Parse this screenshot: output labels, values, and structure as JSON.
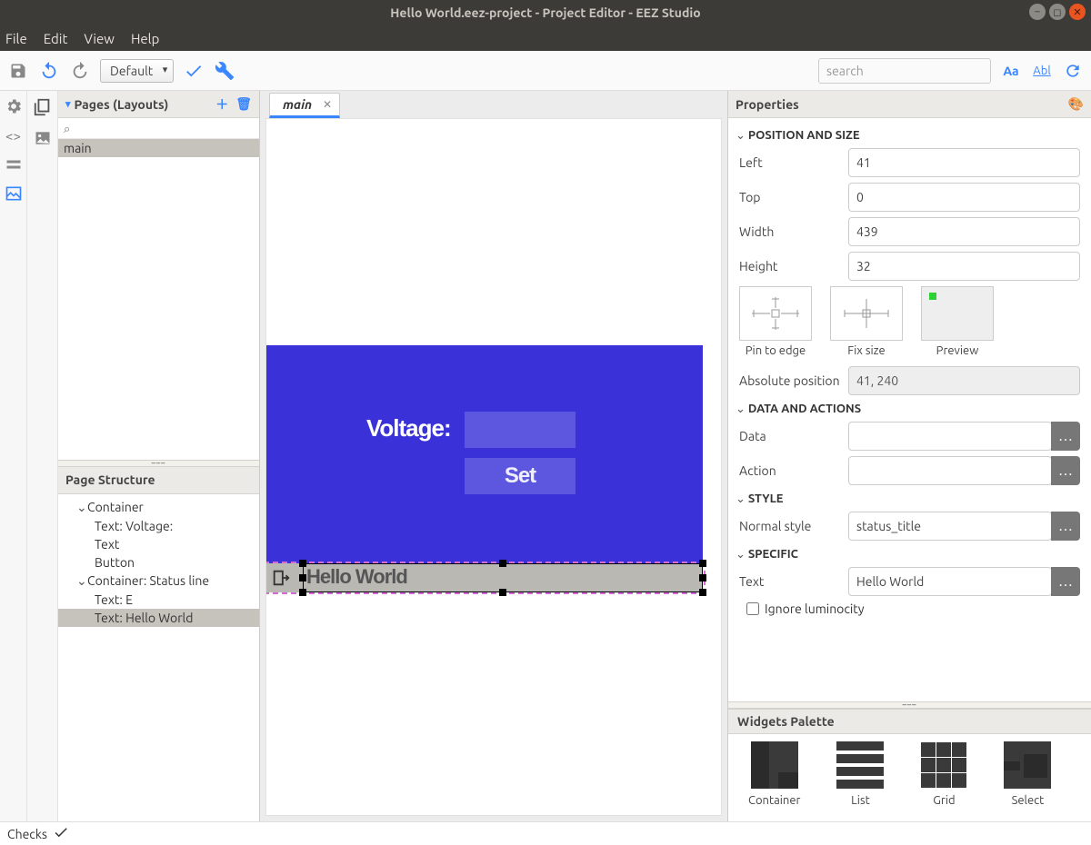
{
  "window": {
    "title": "Hello World.eez-project - Project Editor - EEZ Studio"
  },
  "menu": {
    "items": [
      "File",
      "Edit",
      "View",
      "Help"
    ]
  },
  "toolbar": {
    "variant": "Default",
    "search_placeholder": "search"
  },
  "left": {
    "pages_label": "Pages (Layouts)",
    "page_items": [
      "main"
    ],
    "structure_label": "Page Structure",
    "structure": {
      "container": "Container",
      "text_voltage": "Text: Voltage:",
      "text": "Text",
      "button": "Button",
      "container_status": "Container: Status line",
      "text_e": "Text: E",
      "text_hello": "Text: Hello World"
    }
  },
  "tabs": {
    "main": "main"
  },
  "canvas": {
    "voltage_label": "Voltage:",
    "set_label": "Set",
    "hello_world": "Hello World"
  },
  "properties": {
    "panel_label": "Properties",
    "section_position": "POSITION AND SIZE",
    "left_label": "Left",
    "left_value": "41",
    "top_label": "Top",
    "top_value": "0",
    "width_label": "Width",
    "width_value": "439",
    "height_label": "Height",
    "height_value": "32",
    "pin_label": "Pin to edge",
    "fixsize_label": "Fix size",
    "preview_label": "Preview",
    "abs_label": "Absolute position",
    "abs_value": "41, 240",
    "section_data": "DATA AND ACTIONS",
    "data_label": "Data",
    "data_value": "",
    "action_label": "Action",
    "action_value": "",
    "section_style": "STYLE",
    "style_label": "Normal style",
    "style_value": "status_title",
    "section_specific": "SPECIFIC",
    "text_label": "Text",
    "text_value": "Hello World",
    "ignore_label": "Ignore luminocity"
  },
  "palette": {
    "label": "Widgets Palette",
    "container": "Container",
    "list": "List",
    "grid": "Grid",
    "select": "Select"
  },
  "status": {
    "checks": "Checks"
  }
}
